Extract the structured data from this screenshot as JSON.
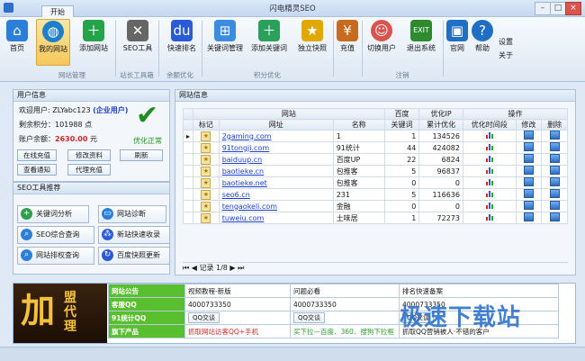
{
  "window": {
    "title": "闪电精灵SEO",
    "tab_start": "开始"
  },
  "ribbon": {
    "buttons": [
      {
        "label": "首页",
        "icon": "home-icon",
        "color": "#2c7fd8"
      },
      {
        "label": "我的网站",
        "icon": "globe-icon",
        "color": "#1d7fc9"
      },
      {
        "label": "添加网站",
        "icon": "add-site-icon",
        "color": "#25a34a"
      },
      {
        "label": "SEO工具",
        "icon": "wrench-icon",
        "color": "#555555"
      },
      {
        "label": "快速排名",
        "icon": "baidu-paw-icon",
        "color": "#2a5bd7"
      },
      {
        "label": "关键词管理",
        "icon": "network-icon",
        "color": "#3b8be0"
      },
      {
        "label": "添加关键词",
        "icon": "add-keyword-icon",
        "color": "#2aa05a"
      },
      {
        "label": "独立快照",
        "icon": "star-icon",
        "color": "#e0a800"
      },
      {
        "label": "充值",
        "icon": "recharge-icon",
        "color": "#c96b1f"
      },
      {
        "label": "切换用户",
        "icon": "user-icon",
        "color": "#d9534f"
      },
      {
        "label": "退出系统",
        "icon": "exit-icon",
        "color": "#2d8a2d"
      },
      {
        "label": "官网",
        "icon": "website-icon",
        "color": "#1f6fc4"
      },
      {
        "label": "帮助",
        "icon": "help-icon",
        "color": "#1f6fc4"
      }
    ],
    "groups": [
      "网站管理",
      "站长工具箱",
      "余额优化",
      "积分优化",
      "注销"
    ],
    "side": {
      "settings": "设置",
      "about": "关于"
    }
  },
  "userinfo": {
    "title": "用户信息",
    "welcome": "欢迎用户: ZLYabc123",
    "vip": "(企业用户)",
    "points": "剩余积分：101988 点",
    "balance_label": "账户余额：",
    "balance": "2630.00",
    "balance_unit": "元",
    "status": "优化正常",
    "btns": [
      "在线充值",
      "修改资料",
      "刷新",
      "查看通知",
      "代理充值"
    ]
  },
  "seo_tools": {
    "title": "SEO工具推荐",
    "items": [
      {
        "label": "关键词分析",
        "icon": "plus-icon",
        "color": "#2aa04a"
      },
      {
        "label": "网站诊断",
        "icon": "monitor-icon",
        "color": "#2c7fd8"
      },
      {
        "label": "SEO综合查询",
        "icon": "magnifier-icon",
        "color": "#2c7fd8"
      },
      {
        "label": "新站快速收录",
        "icon": "baidu-paw-icon",
        "color": "#2a5bd7"
      },
      {
        "label": "网站排权查询",
        "icon": "search-doc-icon",
        "color": "#2c7fd8"
      },
      {
        "label": "百度快照更新",
        "icon": "refresh-icon",
        "color": "#2a5bd7"
      }
    ]
  },
  "site_info": {
    "title": "网站信息",
    "group_headers": {
      "site": "网站",
      "baidu": "百度",
      "opt": "优化IP",
      "ops": "操作"
    },
    "columns": [
      "标记",
      "网址",
      "名称",
      "关键词",
      "累计优化",
      "优化时间段",
      "修改",
      "删除"
    ],
    "rows": [
      {
        "url": "2gaming.com",
        "name": "1",
        "kw": "1",
        "total": "134526"
      },
      {
        "url": "91tongji.com",
        "name": "91统计",
        "kw": "44",
        "total": "424082"
      },
      {
        "url": "baiduup.cn",
        "name": "百度UP",
        "kw": "22",
        "total": "6824"
      },
      {
        "url": "baotieke.cn",
        "name": "包推客",
        "kw": "5",
        "total": "96837"
      },
      {
        "url": "baotieke.net",
        "name": "包推客",
        "kw": "0",
        "total": "0"
      },
      {
        "url": "seo6.cn",
        "name": "231",
        "kw": "5",
        "total": "116636"
      },
      {
        "url": "tengaokeli.com",
        "name": "金融",
        "kw": "0",
        "total": "0"
      },
      {
        "url": "tuweiu.com",
        "name": "土味居",
        "kw": "1",
        "total": "72273"
      }
    ],
    "pager": "记录 1/8"
  },
  "bottom": {
    "ad_text_big": "加",
    "ad_text_small": "盟代理",
    "rows": [
      {
        "label": "网站公告",
        "c1": "视频教程-新版",
        "c2": "问题必看",
        "c3": "排名快速备案"
      },
      {
        "label": "客服QQ",
        "c1": "4000733350",
        "c2": "4000733350",
        "c3": "4000733350"
      },
      {
        "label": "91统计QQ",
        "c1": "QQ交谈",
        "c2": "QQ交谈",
        "c3": "QQ交谈"
      },
      {
        "label": "旗下产品",
        "c1": "抓取网站访客QQ+手机",
        "c2": "买下拉—百度、360、搜狗下拉框",
        "c3": "抓取QQ营销被人·不错的客户"
      }
    ]
  },
  "watermark": "极速下载站"
}
